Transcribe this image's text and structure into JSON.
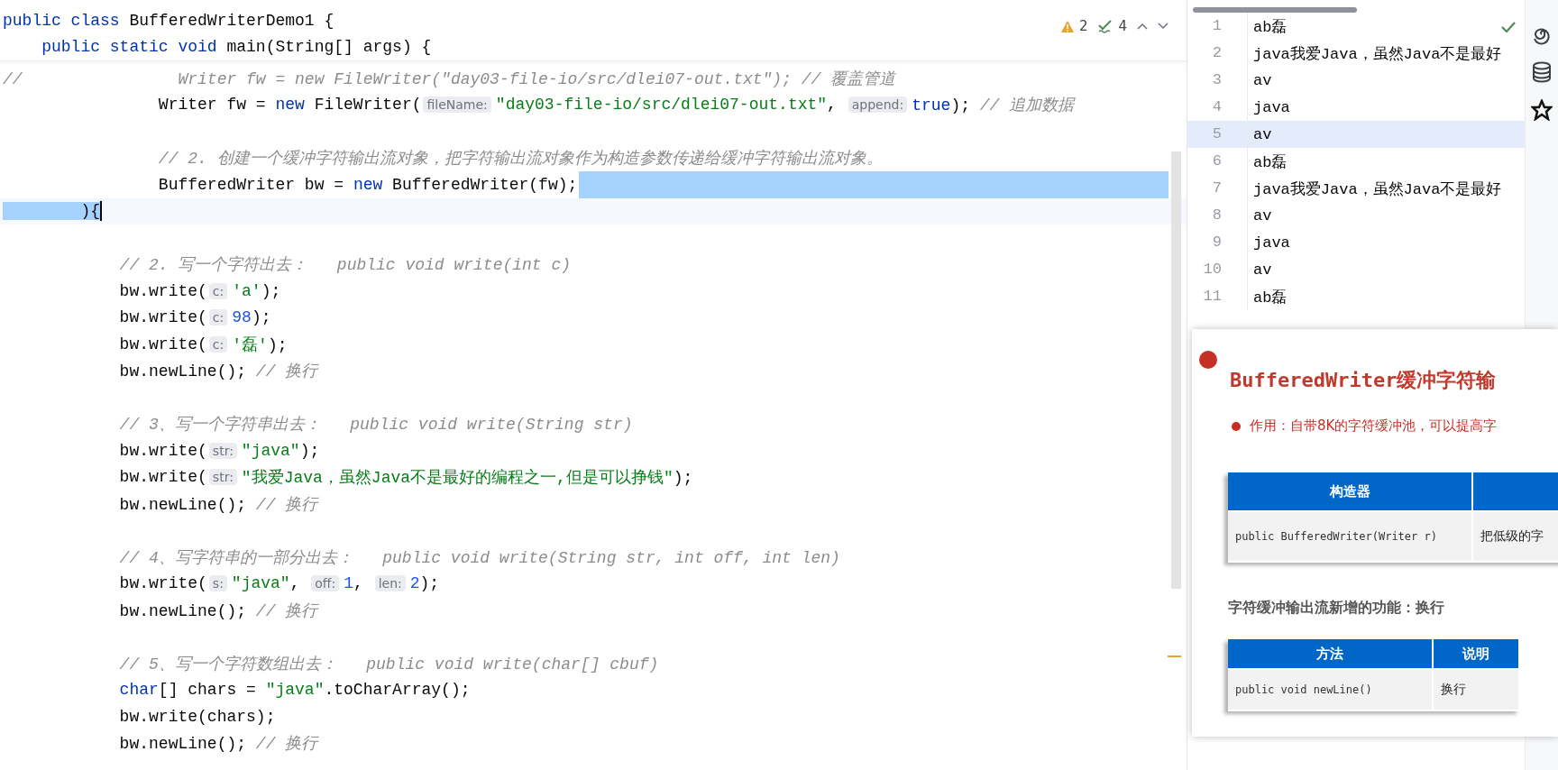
{
  "editor": {
    "inspections": {
      "warnings": "2",
      "checks": "4"
    },
    "sticky_lines": [
      {
        "tokens": [
          {
            "kind": "keyword",
            "text": "public class "
          },
          {
            "kind": "plain",
            "text": "BufferedWriterDemo1 {"
          }
        ]
      },
      {
        "tokens": [
          {
            "kind": "keyword",
            "text": "    public static void "
          },
          {
            "kind": "plain",
            "text": "main(String[] args) {"
          }
        ]
      }
    ],
    "lines": [
      {
        "kind": "code",
        "tokens": [
          {
            "kind": "comment",
            "text": "//                Writer fw = new FileWriter(\"day03-file-io/src/dlei07-out.txt\"); // 覆盖管道"
          }
        ]
      },
      {
        "kind": "code",
        "tokens": [
          {
            "kind": "plain",
            "text": "                Writer fw = "
          },
          {
            "kind": "keyword",
            "text": "new"
          },
          {
            "kind": "plain",
            "text": " FileWriter("
          },
          {
            "kind": "hint",
            "text": "fileName:"
          },
          {
            "kind": "string",
            "text": "\"day03-file-io/src/dlei07-out.txt\""
          },
          {
            "kind": "plain",
            "text": ", "
          },
          {
            "kind": "hint",
            "text": "append:"
          },
          {
            "kind": "keyword",
            "text": "true"
          },
          {
            "kind": "plain",
            "text": "); "
          },
          {
            "kind": "comment",
            "text": "// 追加数据"
          }
        ]
      },
      {
        "kind": "blank"
      },
      {
        "kind": "code",
        "tokens": [
          {
            "kind": "comment",
            "text": "                // 2. 创建一个缓冲字符输出流对象，把字符输出流对象作为构造参数传递给缓冲字符输出流对象。"
          }
        ]
      },
      {
        "kind": "code",
        "selected_to_end": true,
        "tokens": [
          {
            "kind": "plain",
            "text": "                BufferedWriter bw = "
          },
          {
            "kind": "keyword",
            "text": "new"
          },
          {
            "kind": "plain",
            "text": " BufferedWriter(fw);"
          }
        ]
      },
      {
        "kind": "code",
        "caret": true,
        "tokens": [
          {
            "kind": "plain",
            "text": "        ){",
            "selected": true
          }
        ]
      },
      {
        "kind": "blank"
      },
      {
        "kind": "code",
        "tokens": [
          {
            "kind": "comment",
            "text": "            // 2. 写一个字符出去：   public void write(int c)"
          }
        ]
      },
      {
        "kind": "code",
        "tokens": [
          {
            "kind": "plain",
            "text": "            bw.write("
          },
          {
            "kind": "hint",
            "text": "c:"
          },
          {
            "kind": "string",
            "text": "'a'"
          },
          {
            "kind": "plain",
            "text": ");"
          }
        ]
      },
      {
        "kind": "code",
        "tokens": [
          {
            "kind": "plain",
            "text": "            bw.write("
          },
          {
            "kind": "hint",
            "text": "c:"
          },
          {
            "kind": "number",
            "text": "98"
          },
          {
            "kind": "plain",
            "text": ");"
          }
        ]
      },
      {
        "kind": "code",
        "tokens": [
          {
            "kind": "plain",
            "text": "            bw.write("
          },
          {
            "kind": "hint",
            "text": "c:"
          },
          {
            "kind": "string",
            "text": "'磊'"
          },
          {
            "kind": "plain",
            "text": ");"
          }
        ]
      },
      {
        "kind": "code",
        "tokens": [
          {
            "kind": "plain",
            "text": "            bw.newLine(); "
          },
          {
            "kind": "comment",
            "text": "// 换行"
          }
        ]
      },
      {
        "kind": "blank"
      },
      {
        "kind": "code",
        "tokens": [
          {
            "kind": "comment",
            "text": "            // 3、写一个字符串出去：   public void write(String str)"
          }
        ]
      },
      {
        "kind": "code",
        "tokens": [
          {
            "kind": "plain",
            "text": "            bw.write("
          },
          {
            "kind": "hint",
            "text": "str:"
          },
          {
            "kind": "string",
            "text": "\"java\""
          },
          {
            "kind": "plain",
            "text": ");"
          }
        ]
      },
      {
        "kind": "code",
        "tokens": [
          {
            "kind": "plain",
            "text": "            bw.write("
          },
          {
            "kind": "hint",
            "text": "str:"
          },
          {
            "kind": "string",
            "text": "\"我爱Java，虽然Java不是最好的编程之一,但是可以挣钱\""
          },
          {
            "kind": "plain",
            "text": ");"
          }
        ]
      },
      {
        "kind": "code",
        "tokens": [
          {
            "kind": "plain",
            "text": "            bw.newLine(); "
          },
          {
            "kind": "comment",
            "text": "// 换行"
          }
        ]
      },
      {
        "kind": "blank"
      },
      {
        "kind": "code",
        "tokens": [
          {
            "kind": "comment",
            "text": "            // 4、写字符串的一部分出去：   public void write(String str, int off, int len)"
          }
        ]
      },
      {
        "kind": "code",
        "tokens": [
          {
            "kind": "plain",
            "text": "            bw.write("
          },
          {
            "kind": "hint",
            "text": "s:"
          },
          {
            "kind": "string",
            "text": "\"java\""
          },
          {
            "kind": "plain",
            "text": ", "
          },
          {
            "kind": "hint",
            "text": "off:"
          },
          {
            "kind": "number",
            "text": "1"
          },
          {
            "kind": "plain",
            "text": ", "
          },
          {
            "kind": "hint",
            "text": "len:"
          },
          {
            "kind": "number",
            "text": "2"
          },
          {
            "kind": "plain",
            "text": ");"
          }
        ]
      },
      {
        "kind": "code",
        "tokens": [
          {
            "kind": "plain",
            "text": "            bw.newLine(); "
          },
          {
            "kind": "comment",
            "text": "// 换行"
          }
        ]
      },
      {
        "kind": "blank"
      },
      {
        "kind": "code",
        "tokens": [
          {
            "kind": "comment",
            "text": "            // 5、写一个字符数组出去：   public void write(char[] cbuf)"
          }
        ]
      },
      {
        "kind": "code",
        "tokens": [
          {
            "kind": "keyword",
            "text": "            char"
          },
          {
            "kind": "plain",
            "text": "[] chars = "
          },
          {
            "kind": "string",
            "text": "\"java\""
          },
          {
            "kind": "plain",
            "text": ".toCharArray();"
          }
        ]
      },
      {
        "kind": "code",
        "tokens": [
          {
            "kind": "plain",
            "text": "            bw.write(chars);"
          }
        ]
      },
      {
        "kind": "code",
        "tokens": [
          {
            "kind": "plain",
            "text": "            bw.newLine(); "
          },
          {
            "kind": "comment",
            "text": "// 换行"
          }
        ]
      }
    ]
  },
  "output_file": {
    "lines": [
      {
        "number": "1",
        "text": "ab磊",
        "current": false
      },
      {
        "number": "2",
        "text": "java我爱Java，虽然Java不是最好",
        "current": false
      },
      {
        "number": "3",
        "text": "av",
        "current": false
      },
      {
        "number": "4",
        "text": "java",
        "current": false
      },
      {
        "number": "5",
        "text": "av",
        "current": true
      },
      {
        "number": "6",
        "text": "ab磊",
        "current": false
      },
      {
        "number": "7",
        "text": "java我爱Java，虽然Java不是最好",
        "current": false
      },
      {
        "number": "8",
        "text": "av",
        "current": false
      },
      {
        "number": "9",
        "text": "java",
        "current": false
      },
      {
        "number": "10",
        "text": "av",
        "current": false
      },
      {
        "number": "11",
        "text": "ab磊",
        "current": false
      }
    ]
  },
  "slide": {
    "title": "BufferedWriter缓冲字符输",
    "bullet": "作用：自带8K的字符缓冲池，可以提高字",
    "constructor_table": {
      "columns": [
        "构造器"
      ],
      "rows": [
        [
          "public BufferedWriter(Writer r)",
          "把低级的字"
        ]
      ]
    },
    "section_heading": "字符缓冲输出流新增的功能：换行",
    "method_table": {
      "columns": [
        "方法",
        "说明"
      ],
      "rows": [
        [
          "public void newLine()",
          "换行"
        ]
      ]
    }
  }
}
